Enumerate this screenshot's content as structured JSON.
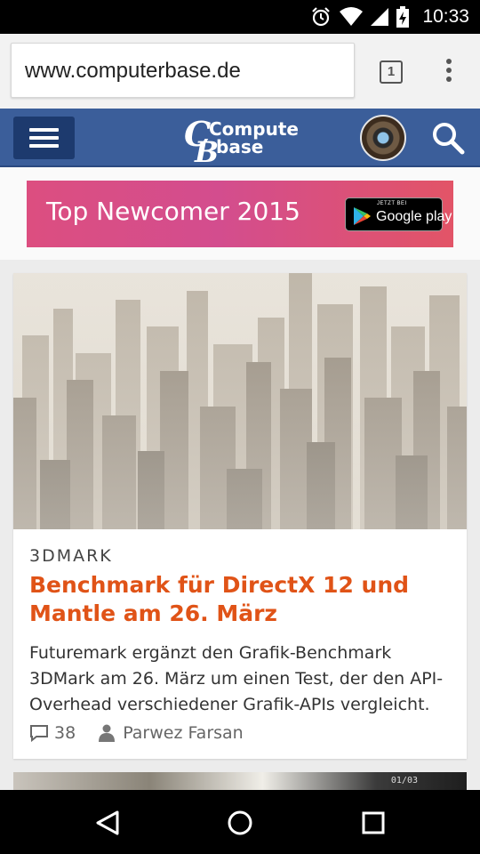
{
  "status_bar": {
    "time": "10:33",
    "icons": [
      "alarm-icon",
      "wifi-icon",
      "signal-icon",
      "battery-charging-icon"
    ]
  },
  "browser": {
    "url": "www.computerbase.de",
    "tab_count": "1"
  },
  "site_header": {
    "logo_line1": "Computer",
    "logo_line2": "base",
    "brand_color": "#3b5e9a"
  },
  "ad": {
    "text": "Top Newcomer 2015",
    "badge_small": "JETZT BEI",
    "badge_big": "Google play"
  },
  "article": {
    "category": "3DMARK",
    "headline": "Benchmark für DirectX 12 und Mantle am 26. März",
    "teaser": "Futuremark ergänzt den Grafik-Benchmark 3DMark am 26. März um einen Test, der den API-Overhead verschiedener Grafik-APIs vergleicht.",
    "comments": "38",
    "author": "Parwez Farsan",
    "accent_color": "#e05317"
  },
  "next_article": {
    "image_text": "01/03"
  }
}
